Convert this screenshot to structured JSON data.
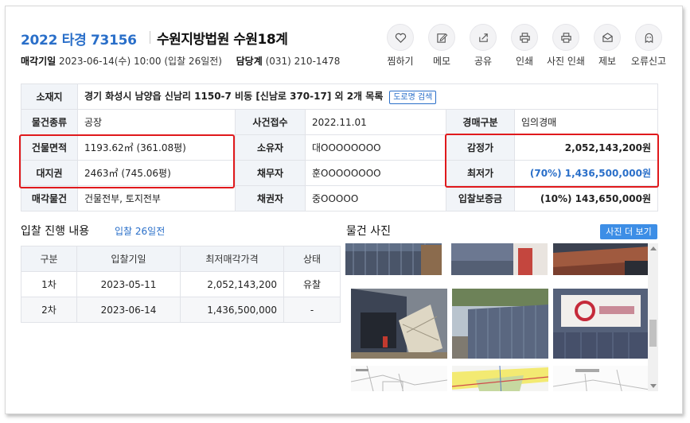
{
  "header": {
    "case_number": "2022 타경 73156",
    "court": "수원지방법원 수원18계",
    "sale_date_label": "매각기일",
    "sale_date_value": "2023-06-14(수) 10:00 (입찰 26일전)",
    "manager_label": "담당계",
    "manager_value": "(031) 210-1478"
  },
  "actions": [
    {
      "label": "찜하기",
      "icon": "heart-icon"
    },
    {
      "label": "메모",
      "icon": "pencil-icon"
    },
    {
      "label": "공유",
      "icon": "share-icon"
    },
    {
      "label": "인쇄",
      "icon": "printer-icon"
    },
    {
      "label": "사진 인쇄",
      "icon": "printer-icon"
    },
    {
      "label": "제보",
      "icon": "envelope-icon"
    },
    {
      "label": "오류신고",
      "icon": "ghost-icon"
    }
  ],
  "info": {
    "location_label": "소재지",
    "location_value": "경기 화성시 남양읍 신남리 1150-7 비동 [신남로 370-17] 외 2개 목록",
    "road_search_label": "도로명 검색",
    "type_label": "물건종류",
    "type_value": "공장",
    "received_label": "사건접수",
    "received_value": "2022.11.01",
    "auction_type_label": "경매구분",
    "auction_type_value": "임의경매",
    "building_area_label": "건물면적",
    "building_area_value": "1193.62㎡ (361.08평)",
    "owner_label": "소유자",
    "owner_value": "대OOOOOOOO",
    "appraisal_label": "감정가",
    "appraisal_value": "2,052,143,200원",
    "land_right_label": "대지권",
    "land_right_value": "2463㎡ (745.06평)",
    "debtor_label": "채무자",
    "debtor_value": "훈OOOOOOOO",
    "min_price_label": "최저가",
    "min_price_value": "(70%) 1,436,500,000원",
    "sale_item_label": "매각물건",
    "sale_item_value": "건물전부, 토지전부",
    "creditor_label": "채권자",
    "creditor_value": "중OOOOO",
    "deposit_label": "입찰보증금",
    "deposit_value": "(10%) 143,650,000원"
  },
  "bid_progress": {
    "title": "입찰 진행 내용",
    "subtitle": "입찰 26일전",
    "columns": [
      "구분",
      "입찰기일",
      "최저매각가격",
      "상태"
    ],
    "rows": [
      [
        "1차",
        "2023-05-11",
        "2,052,143,200",
        "유찰"
      ],
      [
        "2차",
        "2023-06-14",
        "1,436,500,000",
        "-"
      ]
    ]
  },
  "photos": {
    "title": "물건 사진",
    "more_label": "사진 더 보기"
  },
  "colors": {
    "accent": "#2a6fc9",
    "highlight_border": "#e0191c",
    "header_cell_bg": "#f1f4f8",
    "button_bg": "#3d8ee6"
  }
}
